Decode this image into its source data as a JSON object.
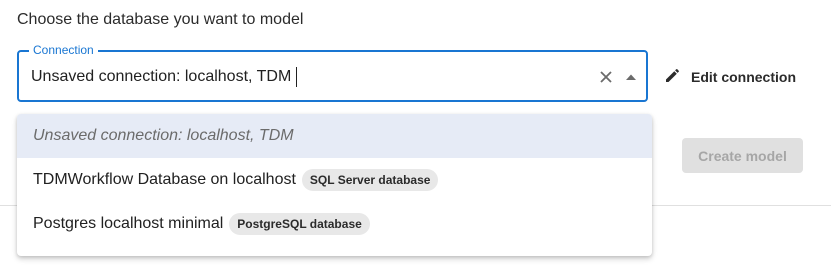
{
  "heading": "Choose the database you want to model",
  "connection_field": {
    "label": "Connection",
    "value": "Unsaved connection: localhost, TDM"
  },
  "icons": {
    "clear": "close-icon",
    "dropdown": "arrow-drop-up-icon",
    "edit": "pencil-icon"
  },
  "edit_button": {
    "label": "Edit connection"
  },
  "create_button": {
    "label": "Create model",
    "disabled": true
  },
  "options": [
    {
      "label": "Unsaved connection: localhost, TDM",
      "chip": "",
      "selected": true
    },
    {
      "label": "TDMWorkflow Database on localhost",
      "chip": "SQL Server database",
      "selected": false
    },
    {
      "label": "Postgres localhost minimal",
      "chip": "PostgreSQL database",
      "selected": false
    }
  ],
  "colors": {
    "accent": "#1976d2",
    "selected_option_bg": "#e6ebf6",
    "disabled_button_bg": "#e0e0e0",
    "chip_bg": "#e8e8e8"
  }
}
